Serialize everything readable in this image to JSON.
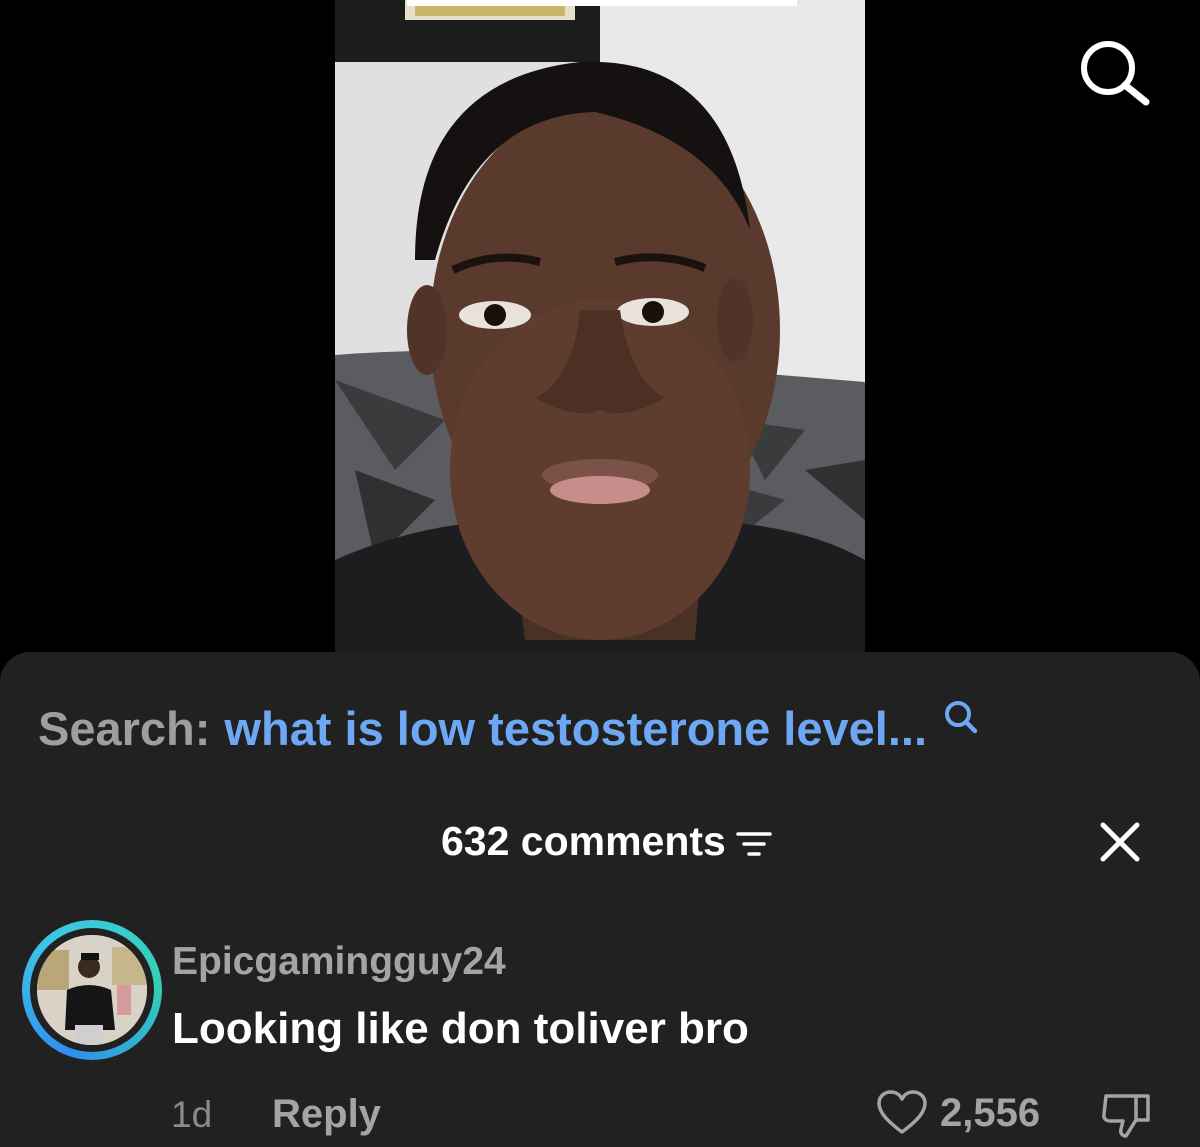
{
  "video": {
    "top_search_icon": "search-icon"
  },
  "search_suggestion": {
    "prefix": "Search:",
    "query": "what is low testosterone level...",
    "icon": "search-icon",
    "query_color": "#6ea8f5"
  },
  "comments_panel": {
    "title": "632 comments",
    "sort_icon": "sort-icon",
    "close_icon": "close-icon",
    "background": "#212121"
  },
  "comments": [
    {
      "username": "Epicgamingguy24",
      "text": "Looking like don toliver bro",
      "time_ago": "1d",
      "reply_label": "Reply",
      "likes": "2,556",
      "like_icon": "heart-icon",
      "dislike_icon": "thumbs-down-icon"
    }
  ]
}
